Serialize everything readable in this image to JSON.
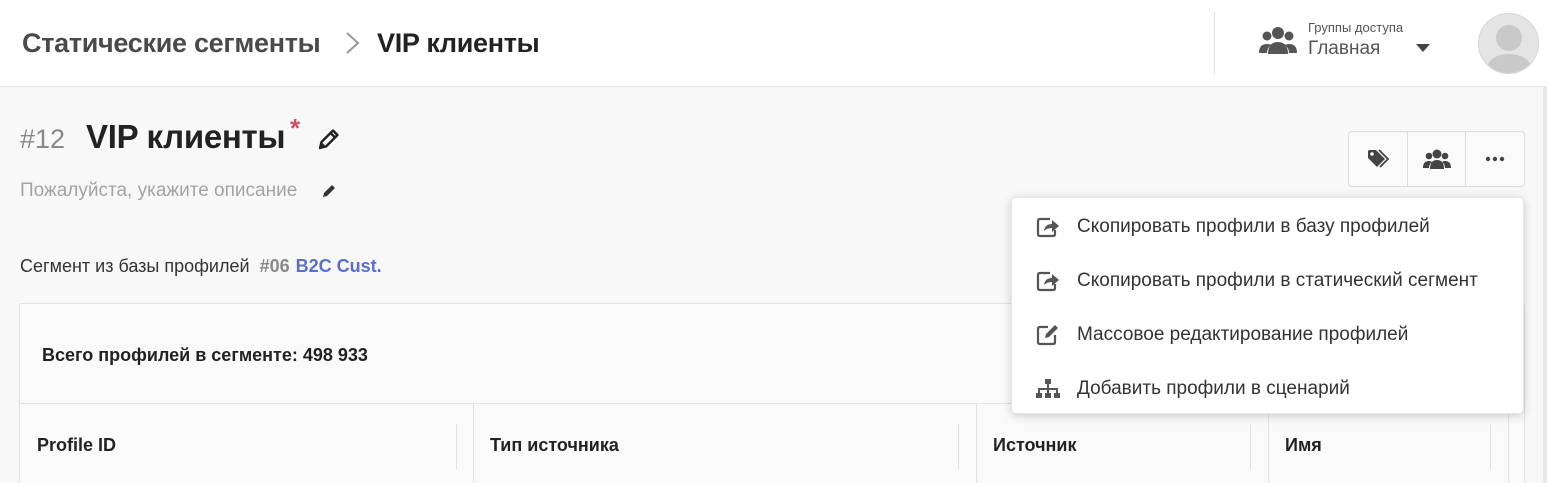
{
  "header": {
    "breadcrumb_root": "Статические сегменты",
    "breadcrumb_current": "VIP клиенты",
    "access_groups_label": "Группы доступа",
    "access_groups_value": "Главная"
  },
  "segment": {
    "number": "#12",
    "title": "VIP клиенты",
    "required_mark": "*",
    "description_placeholder": "Пожалуйста, укажите описание",
    "source_label": "Сегмент из базы профилей",
    "source_db_number": "#06",
    "source_db_name": "B2C Cust."
  },
  "summary": {
    "total_label": "Всего профилей в сегменте: 498 933"
  },
  "table": {
    "columns": [
      "Profile ID",
      "Тип источника",
      "Источник",
      "Имя"
    ]
  },
  "actions": {
    "buttons": [
      "tags-icon",
      "users-icon",
      "more-icon"
    ]
  },
  "menu": {
    "items": [
      {
        "label": "Скопировать профили в базу профилей",
        "icon": "copy-export-icon"
      },
      {
        "label": "Скопировать профили в статический сегмент",
        "icon": "copy-export-icon"
      },
      {
        "label": "Массовое редактирование профилей",
        "icon": "edit-square-icon"
      },
      {
        "label": "Добавить профили в сценарий",
        "icon": "sitemap-icon"
      }
    ]
  },
  "colors": {
    "accent_link": "#5b6fc7",
    "required": "#d0506e"
  }
}
